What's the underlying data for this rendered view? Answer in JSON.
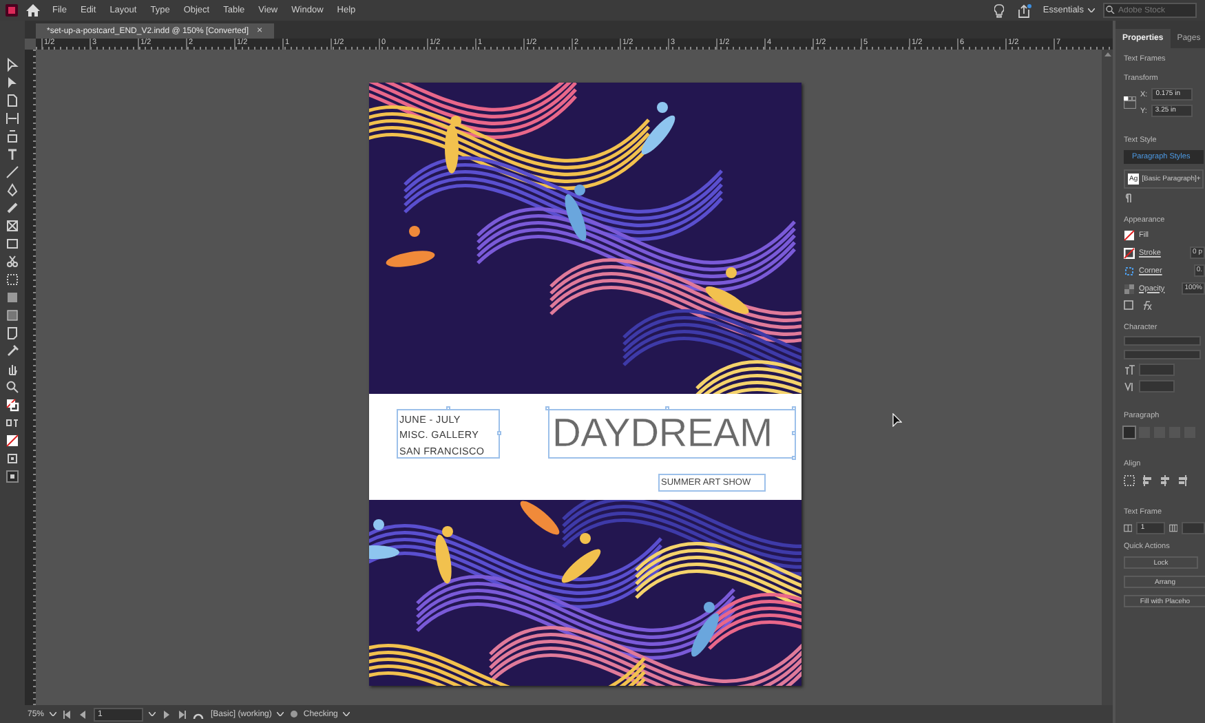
{
  "menu_bar": {
    "items": [
      "File",
      "Edit",
      "Layout",
      "Type",
      "Object",
      "Table",
      "View",
      "Window",
      "Help"
    ],
    "workspace": "Essentials",
    "search": {
      "placeholder": "Adobe Stock"
    }
  },
  "document_tab": {
    "title": "*set-up-a-postcard_END_V2.indd @ 150% [Converted]",
    "close": "×"
  },
  "ruler": {
    "labels": [
      "1/2",
      "3",
      "1/2",
      "2",
      "1/2",
      "1",
      "1/2",
      "0",
      "1/2",
      "1",
      "1/2",
      "2",
      "1/2",
      "3",
      "1/2",
      "4",
      "1/2",
      "5",
      "1/2",
      "6",
      "1/2",
      "7"
    ]
  },
  "postcard": {
    "info_lines": [
      "JUNE - JULY",
      "MISC. GALLERY",
      "SAN FRANCISCO"
    ],
    "title": "DAYDREAM",
    "subtitle": "SUMMER ART SHOW"
  },
  "properties_panel": {
    "tabs": [
      {
        "label": "Properties",
        "selected": true
      },
      {
        "label": "Pages",
        "selected": false
      }
    ],
    "context": "Text Frames",
    "transform": {
      "title": "Transform",
      "x_label": "X:",
      "x_value": "0.175 in",
      "y_label": "Y:",
      "y_value": "3.25 in"
    },
    "text_style": {
      "title": "Text Style",
      "tab": "Paragraph Styles",
      "swatch": "Ag",
      "style": "[Basic Paragraph]+"
    },
    "appearance": {
      "title": "Appearance",
      "rows": [
        {
          "kind": "fill",
          "label": "Fill"
        },
        {
          "kind": "stroke",
          "label": "Stroke",
          "value": "0 p"
        },
        {
          "kind": "corner",
          "label": "Corner",
          "value": "0."
        },
        {
          "kind": "opacity",
          "label": "Opacity",
          "value": "100%"
        }
      ]
    },
    "character": {
      "title": "Character"
    },
    "paragraph": {
      "title": "Paragraph",
      "alignments": [
        {
          "selected": true
        },
        {
          "selected": false
        },
        {
          "selected": false
        },
        {
          "selected": false
        },
        {
          "selected": false
        }
      ]
    },
    "align": {
      "title": "Align"
    },
    "text_frame": {
      "title": "Text Frame",
      "columns": "1"
    },
    "quick_actions": {
      "title": "Quick Actions",
      "buttons": [
        "Lock",
        "Arrang",
        "Fill with Placeho"
      ]
    }
  },
  "status_bar": {
    "zoom": "75%",
    "page": "1",
    "style": "[Basic] (working)",
    "preflight": "Checking"
  }
}
